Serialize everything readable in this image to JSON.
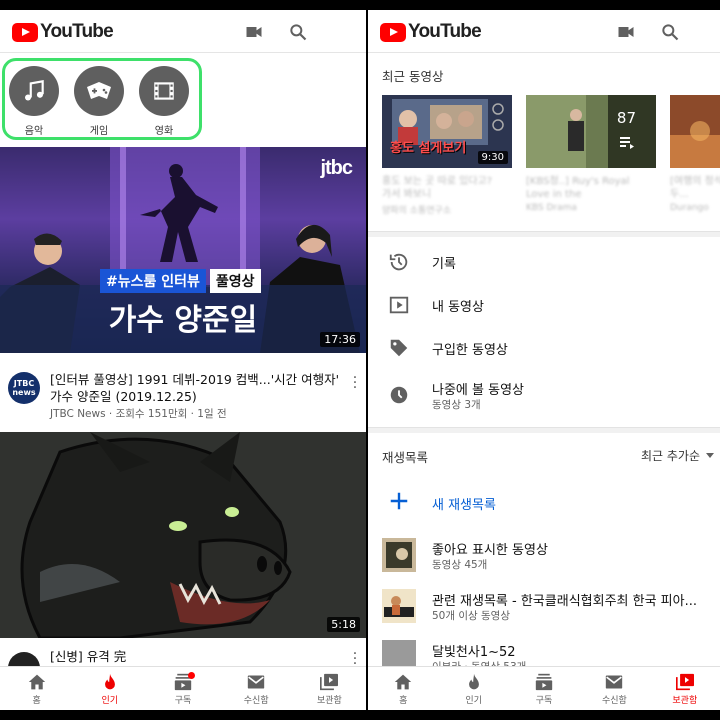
{
  "left": {
    "header": {
      "logo_text": "YouTube",
      "icons": [
        "video-camera-icon",
        "search-icon"
      ]
    },
    "explore": [
      {
        "label": "음악",
        "icon": "music-note-icon"
      },
      {
        "label": "게임",
        "icon": "gamepad-icon"
      },
      {
        "label": "영화",
        "icon": "film-icon"
      }
    ],
    "accent_color": "#3ee06a",
    "video1": {
      "thumb_channel_logo": "jtbc",
      "thumb_tag": "#뉴스룸 인터뷰",
      "thumb_tag2": "풀영상",
      "thumb_caption": "가수 양준일",
      "duration": "17:36",
      "avatar_text": "JTBC news",
      "title": "[인터뷰 풀영상] 1991 데뷔-2019 컴백...'시간 여행자' 가수 양준일 (2019.12.25)",
      "subtitle": "JTBC News · 조회수 151만회 · 1일 전"
    },
    "video2": {
      "duration": "5:18",
      "title": "[신병] 유격 完"
    },
    "nav": [
      {
        "label": "홈",
        "icon": "home-icon"
      },
      {
        "label": "인기",
        "icon": "flame-icon",
        "active": true
      },
      {
        "label": "구독",
        "icon": "subscriptions-icon",
        "badge": true
      },
      {
        "label": "수신함",
        "icon": "mail-icon"
      },
      {
        "label": "보관함",
        "icon": "library-icon"
      }
    ]
  },
  "right": {
    "header": {
      "logo_text": "YouTube",
      "icons": [
        "video-camera-icon",
        "search-icon"
      ]
    },
    "recent_title": "최근 동영상",
    "recent": [
      {
        "duration": "9:30",
        "caption": "홍도 설게보기",
        "blurred_title": "홍도 보는 곳 따로 있다고? 가서 봐보니",
        "blurred_sub": "양파의 소통연구소"
      },
      {
        "count": "87",
        "blurred_title": "[KBS청..] Ruy's Royal Love in the",
        "blurred_sub": "KBS Drama"
      },
      {
        "blurred_title": "[여행의 정석] 두...",
        "blurred_sub": "Durango"
      }
    ],
    "library_items": [
      {
        "label": "기록",
        "icon": "history-icon"
      },
      {
        "label": "내 동영상",
        "icon": "my-videos-icon"
      },
      {
        "label": "구입한 동영상",
        "icon": "tag-icon"
      },
      {
        "label": "나중에 볼 동영상",
        "sub": "동영상 3개",
        "icon": "clock-icon"
      }
    ],
    "playlists_title": "재생목록",
    "sort_label": "최근 추가순",
    "new_playlist": "새 재생목록",
    "playlists": [
      {
        "title": "좋아요 표시한 동영상",
        "sub": "동영상 45개"
      },
      {
        "title": "관련 재생목록 - 한국클래식협회주최 한국 피아...",
        "sub": "50개 이상 동영상"
      },
      {
        "title": "달빛천사1~52",
        "sub": "이부라 · 동영상 53개"
      }
    ],
    "nav": [
      {
        "label": "홈",
        "icon": "home-icon"
      },
      {
        "label": "인기",
        "icon": "flame-icon"
      },
      {
        "label": "구독",
        "icon": "subscriptions-icon"
      },
      {
        "label": "수신함",
        "icon": "mail-icon"
      },
      {
        "label": "보관함",
        "icon": "library-icon",
        "active": true
      }
    ]
  }
}
